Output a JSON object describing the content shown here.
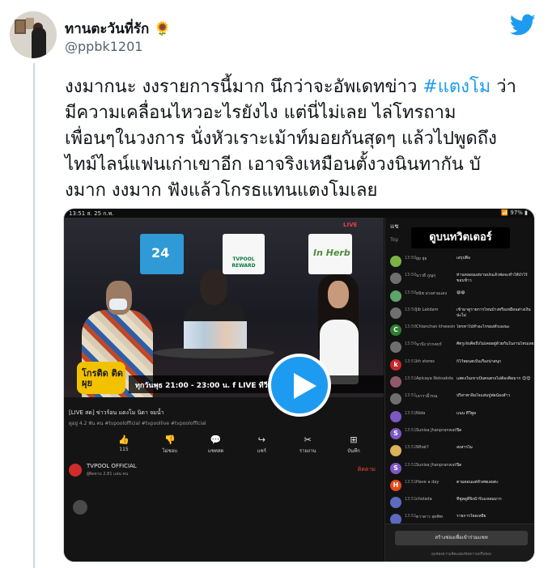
{
  "tweet": {
    "display_name": "ทานตะวันที่รัก 🌻",
    "handle": "@ppbk1201",
    "text_lines": [
      "งงมากนะ งงรายการนี้มาก นึกว่าจะอัพเดทข่าว ",
      "มีความเคลื่อนไหวอะไรยังไง แต่นี่ไม่เลย ไล่โทรถาม",
      "เพื่อนๆในวงการ นั่งหัวเราะเม้าท์มอยกันสุดๆ แล้วไปพูดถึง",
      "ไทม์ไลน์แฟนเก่าเขาอีก เอาจริงเหมือนตั้งวงนินทากัน บั",
      "งมาก งงมาก ฟังแล้วโกรธแทนแตงโมเลย"
    ],
    "hashtag": "#แตงโม",
    "after_hashtag": " ว่า"
  },
  "video": {
    "statusbar_left": "13:51 ส. 25 ก.พ.",
    "statusbar_right": "📶 97% ▮",
    "studio": {
      "logo_24": "24",
      "logo_tvpool": "TVPOOL REWARD",
      "logo_herb": "In Herb",
      "live_tag": "LIVE",
      "show_name": "โกรติด ติดผุย",
      "time_strip": "ทุกวันพุธ 21:00 - 23:00 น.  f LIVE  ทีวีพูล"
    },
    "title": "[LIVE สด] ข่าวร้อน แตงโม นิดา จมน้ำ",
    "meta": "ดูอยู่ 4.2 พัน คน #tvpoolofficial #tvpoollive #tvpoolofficial",
    "actions": [
      {
        "icon": "👍",
        "label": "115"
      },
      {
        "icon": "👎",
        "label": "ไม่ชอบ"
      },
      {
        "icon": "💬",
        "label": "แชทสด"
      },
      {
        "icon": "↪",
        "label": "แชร์"
      },
      {
        "icon": "✂",
        "label": "รายงาน"
      },
      {
        "icon": "⊞",
        "label": "บันทึก"
      }
    ],
    "channel": {
      "name": "TVPOOL OFFICIAL",
      "subs": "ผู้ติดตาม 2.81 แสน คน",
      "subscribe": "ติดตาม"
    },
    "chat": {
      "header": "แช",
      "sub": "Top",
      "overlay": "ดูบนทวิตเตอร์",
      "messages": [
        {
          "time": "13:50",
          "who": "ยุ่ย ยุ่ย",
          "msg": "เสรุปคือ",
          "color": "#7bb342",
          "icon": "person"
        },
        {
          "time": "13:50",
          "who": "นาวธี ภูญกุ",
          "msg": "ท่านหลอนแต่งานปกแล้วพ่อจะทำให้ป่าไร้ขอบข้าว",
          "color": "#6f6f6f",
          "icon": "person"
        },
        {
          "time": "13:50",
          "who": "ธนิช ม่วงสามแดง",
          "msg": "😄😄",
          "color": "#5aa66b",
          "icon": "person"
        },
        {
          "time": "13:50",
          "who": "Jib Lakdam",
          "msg": "เข้ามาดูรายการไหนบ้างหรือเหมือนต่างเงินน่ะไม่",
          "color": "#6f6f6f",
          "icon": "person"
        },
        {
          "time": "13:50",
          "who": "Chianchan khwasin",
          "msg": "โทรหาไปทำอะไรของตัวเองนะ",
          "color": "#2e7d32",
          "icon": "C"
        },
        {
          "time": "13:50",
          "who": "นาปัง ปากคบรั",
          "msg": "ศัตรูเจ็บคิดถึงไม่เคยอยู่ด้วยกันในงานไหนเลย",
          "color": "#6f6f6f",
          "icon": "person"
        },
        {
          "time": "13:51",
          "who": "kh stores",
          "msg": "ก็ไว้พอนตเป็นเรื่องน่าสนุก",
          "color": "#c62828",
          "icon": "k"
        },
        {
          "time": "13:51",
          "who": "Apicaya Noksakda",
          "msg": "แสดงในเขาเป็นคนตรงไม่ต้องคิดมาก 😊😊",
          "color": "#8e5a6b",
          "icon": "person"
        },
        {
          "time": "13:51",
          "who": "เจารามิ้วรณ",
          "msg": "ปริสาพาอิ่มใจแสนปูพ่อน้องสำว",
          "color": "#6f6f6f",
          "icon": "person"
        },
        {
          "time": "13:51",
          "who": "Nida",
          "msg": "แนน ทีวีพูล",
          "color": "#7e57c2",
          "icon": "person"
        },
        {
          "time": "13:51",
          "who": "Sunisa Jhanpranwat",
          "msg": "ปิด",
          "color": "#7e57c2",
          "icon": "S"
        },
        {
          "time": "13:51",
          "who": "What?",
          "msg": "สงสารไม",
          "color": "#d9b25a",
          "icon": "person"
        },
        {
          "time": "13:51",
          "who": "Sunisa Jhanpranwat",
          "msg": "ปิด",
          "color": "#7e57c2",
          "icon": "S"
        },
        {
          "time": "13:51",
          "who": "Have a day",
          "msg": "ตามตอนแต่ทั่วศพเลยค่ะ",
          "color": "#e64a19",
          "icon": "H"
        },
        {
          "time": "13:51",
          "who": "cholada",
          "msg": "ทีพูลดูดีจิ้งน้ำรับแหลมมาก",
          "color": "#5c6bc0",
          "icon": "person"
        },
        {
          "time": "13:51",
          "who": "ตวาดาว สุดพิฑ",
          "msg": "รายการใจดเหยี่ย",
          "color": "#5c6bc0",
          "icon": "person"
        }
      ],
      "join_button": "สร้างช่องเพื่อเข้าร่วมแชท",
      "note": "ยุบช่องความคิดแสดงข้อความหรือช่อง"
    }
  },
  "colors": {
    "twitter_blue": "#1d9bf0",
    "text": "#0f1419",
    "muted": "#536471"
  },
  "icons": {
    "logo": "twitter-bird-icon",
    "play": "play-icon"
  }
}
